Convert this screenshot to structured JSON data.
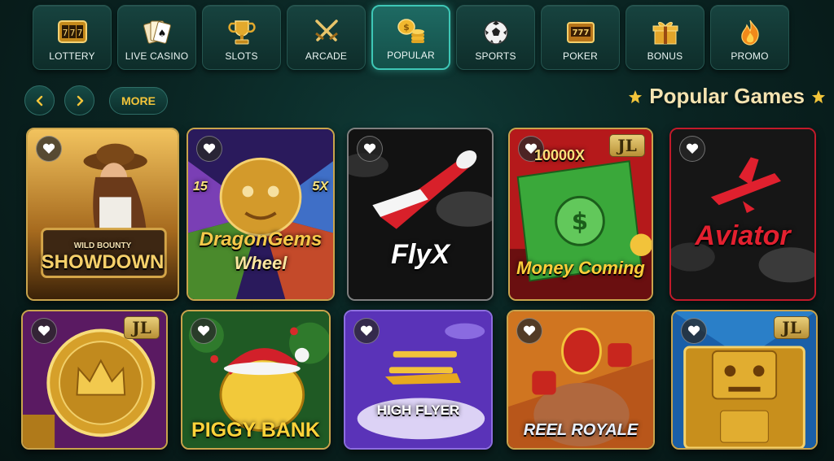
{
  "categories": [
    {
      "label": "LOTTERY",
      "icon": "slot-777-icon"
    },
    {
      "label": "LIVE CASINO",
      "icon": "playing-cards-icon"
    },
    {
      "label": "SLOTS",
      "icon": "trophy-icon"
    },
    {
      "label": "ARCADE",
      "icon": "crossed-swords-icon"
    },
    {
      "label": "POPULAR",
      "icon": "coin-stack-icon",
      "active": true
    },
    {
      "label": "SPORTS",
      "icon": "soccer-ball-icon"
    },
    {
      "label": "POKER",
      "icon": "slot-machine-icon"
    },
    {
      "label": "BONUS",
      "icon": "gift-box-icon"
    },
    {
      "label": "PROMO",
      "icon": "flame-icon"
    }
  ],
  "controls": {
    "more_label": "MORE"
  },
  "section": {
    "title": "Popular Games"
  },
  "games": [
    {
      "title_small": "WILD BOUNTY",
      "title": "SHOWDOWN",
      "jl": false
    },
    {
      "title": "DragonGems",
      "title2": "Wheel",
      "badge_left": "15",
      "badge_right": "5X",
      "jl": false
    },
    {
      "title": "FlyX",
      "jl": false
    },
    {
      "title": "Money Coming",
      "multiplier": "10000X",
      "jl": true,
      "jl_label": "JL"
    },
    {
      "title": "Aviator",
      "jl": false
    },
    {
      "title": "",
      "jl": true,
      "jl_label": "JL"
    },
    {
      "title": "PIGGY BANK",
      "jl": false
    },
    {
      "title": "HIGH FLYER",
      "jl": false
    },
    {
      "title": "REEL ROYALE",
      "jl": false
    },
    {
      "title": "",
      "jl": true,
      "jl_label": "JL"
    }
  ],
  "colors": {
    "accent_gold": "#f3c53a",
    "active_teal": "#3ec7b6",
    "bg_dark": "#0a2422"
  }
}
